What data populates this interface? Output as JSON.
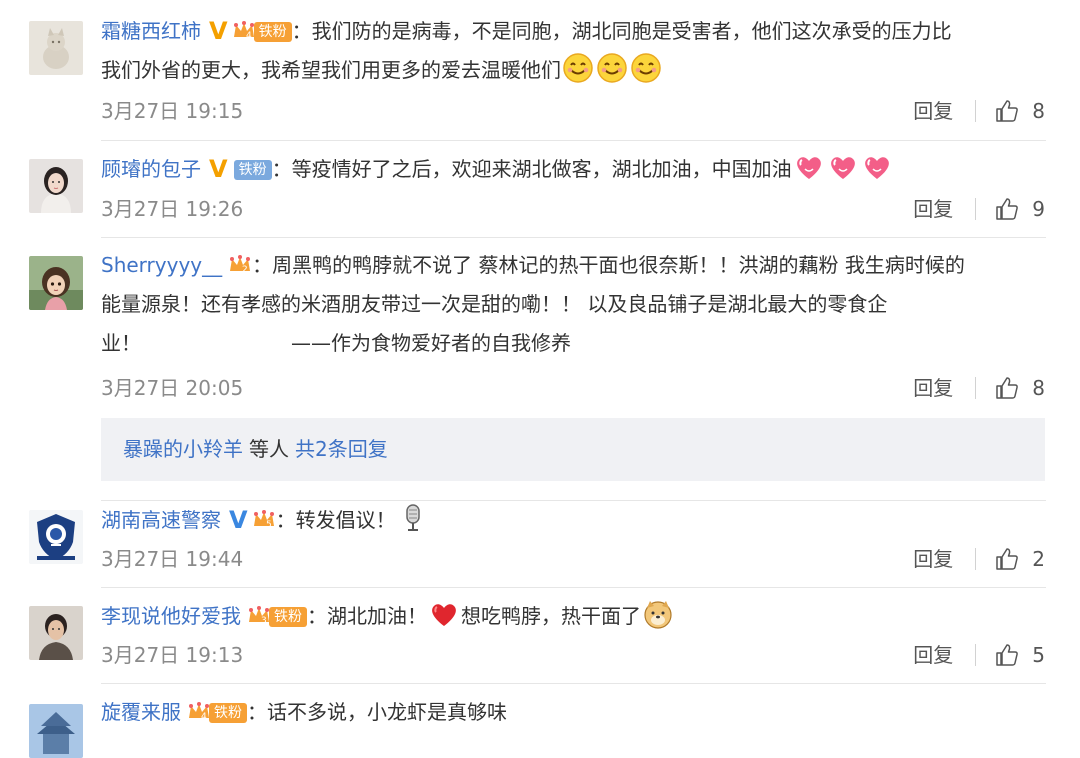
{
  "colors": {
    "link": "#3f73c6",
    "meta": "#8a8a8a",
    "fan_orange": "#f6a035",
    "fan_blue": "#7ba9de",
    "verified_orange": "#f4a000",
    "verified_blue": "#3a87e0"
  },
  "comments": [
    {
      "username": "霜糖西红柿",
      "verified": "V",
      "level": "4",
      "fan_label": "铁粉",
      "text_line1": "我们防的是病毒，不是同胞，湖北同胞是受害者，他们这次承受的压力比",
      "text_line2": "我们外省的更大，我希望我们用更多的爱去温暖他们",
      "emojis": [
        "smile",
        "smile",
        "smile"
      ],
      "time": "3月27日 19:15",
      "reply_label": "回复",
      "likes": "8"
    },
    {
      "username": "顾璿的包子",
      "verified": "V",
      "fan_label": "铁粉",
      "text": "等疫情好了之后，欢迎来湖北做客，湖北加油，中国加油",
      "emojis": [
        "heart-love",
        "heart-love",
        "heart-love"
      ],
      "time": "3月27日 19:26",
      "reply_label": "回复",
      "likes": "9"
    },
    {
      "username": "Sherryyyy__",
      "level": "2",
      "text_line1": "周黑鸭的鸭脖就不说了 蔡林记的热干面也很奈斯！！洪湖的藕粉 我生病时候的",
      "text_line2": "能量源泉！还有孝感的米酒朋友带过一次是甜的嘞！！ 以及良品铺子是湖北最大的零食企",
      "text_line3a": "业！",
      "text_line3b": "——作为食物爱好者的自我修养",
      "time": "3月27日 20:05",
      "reply_label": "回复",
      "likes": "8",
      "replies_preview": {
        "user": "暴躁的小羚羊",
        "middle": "等人",
        "link": "共2条回复"
      }
    },
    {
      "username": "湖南高速警察",
      "verified": "V",
      "level": "5",
      "text": "转发倡议！",
      "emojis": [
        "microphone"
      ],
      "time": "3月27日 19:44",
      "reply_label": "回复",
      "likes": "2"
    },
    {
      "username": "李现说他好爱我",
      "level": "3",
      "fan_label": "铁粉",
      "text_a": "湖北加油！",
      "text_b": "想吃鸭脖，热干面了",
      "emojis": [
        "heart",
        "doge"
      ],
      "time": "3月27日 19:13",
      "reply_label": "回复",
      "likes": "5"
    },
    {
      "username": "旋覆来服",
      "level": "4",
      "fan_label": "铁粉",
      "text": "话不多说，小龙虾是真够味"
    }
  ],
  "avatars": [
    "cat-statue-avatar",
    "girl-portrait-avatar",
    "anime-girl-avatar",
    "police-emblem-avatar",
    "man-portrait-avatar",
    "temple-avatar"
  ]
}
